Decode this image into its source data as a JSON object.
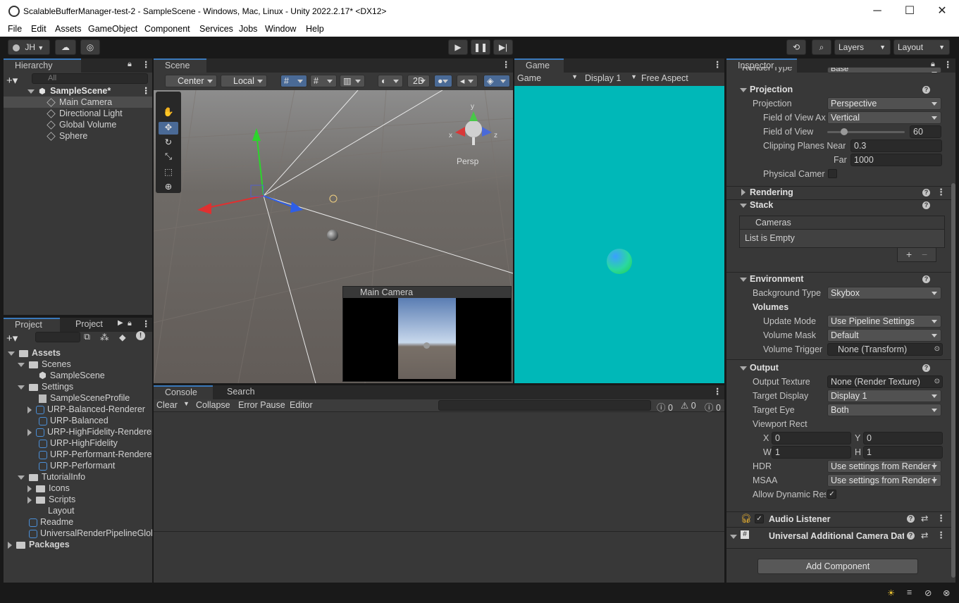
{
  "window": {
    "title": "ScalableBufferManager-test-2 - SampleScene - Windows, Mac, Linux - Unity 2022.2.17* <DX12>",
    "minimize": "─",
    "maximize": "☐",
    "close": "✕"
  },
  "menu": [
    "File",
    "Edit",
    "Assets",
    "GameObject",
    "Component",
    "Services",
    "Jobs",
    "Window",
    "Help"
  ],
  "toolbar": {
    "account": "JH",
    "layers": "Layers",
    "layout": "Layout"
  },
  "hierarchy": {
    "tab": "Hierarchy",
    "search_placeholder": "All",
    "scene": "SampleScene*",
    "items": [
      "Main Camera",
      "Directional Light",
      "Global Volume",
      "Sphere"
    ]
  },
  "scene": {
    "tab": "Scene",
    "pivot": "Center",
    "space": "Local",
    "mode2d": "2D",
    "persp": "Persp",
    "overlay_title": "Main Camera",
    "gizmo_x": "x",
    "gizmo_y": "y",
    "gizmo_z": "z"
  },
  "game": {
    "tab": "Game",
    "view": "Game",
    "display": "Display 1",
    "aspect": "Free Aspect",
    "bg": "#00b8b8"
  },
  "project": {
    "tab1": "Project",
    "tab2": "Project",
    "badge": "11",
    "tree": [
      {
        "label": "Assets",
        "indent": 0,
        "type": "folder-open",
        "bold": true
      },
      {
        "label": "Scenes",
        "indent": 1,
        "type": "folder-open"
      },
      {
        "label": "SampleScene",
        "indent": 2,
        "type": "scene"
      },
      {
        "label": "Settings",
        "indent": 1,
        "type": "folder-open"
      },
      {
        "label": "SampleSceneProfile",
        "indent": 2,
        "type": "profile"
      },
      {
        "label": "URP-Balanced-Renderer",
        "indent": 2,
        "type": "asset-fold"
      },
      {
        "label": "URP-Balanced",
        "indent": 2,
        "type": "asset"
      },
      {
        "label": "URP-HighFidelity-Renderer",
        "indent": 2,
        "type": "asset-fold"
      },
      {
        "label": "URP-HighFidelity",
        "indent": 2,
        "type": "asset"
      },
      {
        "label": "URP-Performant-Renderer",
        "indent": 2,
        "type": "asset"
      },
      {
        "label": "URP-Performant",
        "indent": 2,
        "type": "asset"
      },
      {
        "label": "TutorialInfo",
        "indent": 1,
        "type": "folder-open"
      },
      {
        "label": "Icons",
        "indent": 2,
        "type": "folder"
      },
      {
        "label": "Scripts",
        "indent": 2,
        "type": "folder"
      },
      {
        "label": "Layout",
        "indent": 2,
        "type": "file"
      },
      {
        "label": "Readme",
        "indent": 1,
        "type": "asset"
      },
      {
        "label": "UniversalRenderPipelineGlob",
        "indent": 1,
        "type": "asset"
      },
      {
        "label": "Packages",
        "indent": 0,
        "type": "folder",
        "bold": true
      }
    ]
  },
  "console": {
    "tab": "Console",
    "tab2": "Search",
    "clear": "Clear",
    "collapse": "Collapse",
    "error_pause": "Error Pause",
    "editor": "Editor",
    "count_log": "0",
    "count_warn": "0",
    "count_err": "0"
  },
  "inspector": {
    "tab": "Inspector",
    "render_type_label": "Render Type",
    "render_type_value": "Base",
    "projection_hdr": "Projection",
    "projection_label": "Projection",
    "projection_value": "Perspective",
    "fov_axis_label": "Field of View Ax",
    "fov_axis_value": "Vertical",
    "fov_label": "Field of View",
    "fov_value": "60",
    "fov_fraction": 0.22,
    "near_label": "Clipping Planes Near",
    "near_value": "0.3",
    "far_label": "Far",
    "far_value": "1000",
    "physical_label": "Physical Camer",
    "rendering_hdr": "Rendering",
    "stack_hdr": "Stack",
    "cameras_label": "Cameras",
    "list_empty": "List is Empty",
    "env_hdr": "Environment",
    "bg_type_label": "Background Type",
    "bg_type_value": "Skybox",
    "volumes_label": "Volumes",
    "update_mode_label": "Update Mode",
    "update_mode_value": "Use Pipeline Settings",
    "volume_mask_label": "Volume Mask",
    "volume_mask_value": "Default",
    "volume_trigger_label": "Volume Trigger",
    "volume_trigger_value": "None (Transform)",
    "output_hdr": "Output",
    "output_tex_label": "Output Texture",
    "output_tex_value": "None (Render Texture)",
    "target_display_label": "Target Display",
    "target_display_value": "Display 1",
    "target_eye_label": "Target Eye",
    "target_eye_value": "Both",
    "viewport_label": "Viewport Rect",
    "vx_label": "X",
    "vx": "0",
    "vy_label": "Y",
    "vy": "0",
    "vw_label": "W",
    "vw": "1",
    "vh_label": "H",
    "vh": "1",
    "hdr_label": "HDR",
    "hdr_value": "Use settings from Render I",
    "msaa_label": "MSAA",
    "msaa_value": "Use settings from Render I",
    "dyn_res_label": "Allow Dynamic Res",
    "audio_listener": "Audio Listener",
    "uacd": "Universal Additional Camera Dat",
    "add_component": "Add Component"
  }
}
